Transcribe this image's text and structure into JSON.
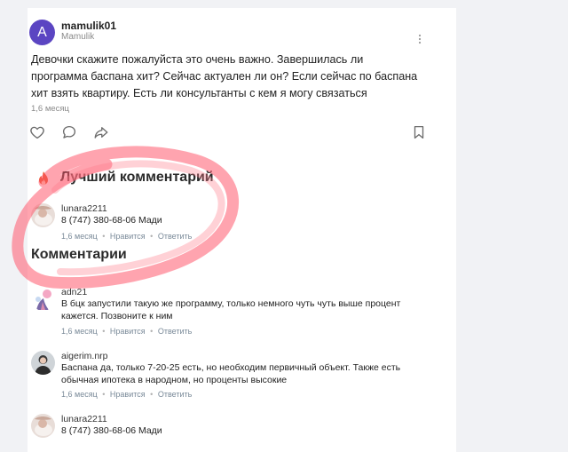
{
  "post": {
    "avatar_letter": "A",
    "author": "mamulik01",
    "author_sub": "Mamulik",
    "text": "Девочки скажите пожалуйста это очень важно. Завершилась ли программа баспана хит? Сейчас актуален ли он? Если сейчас по баспана хит взять квартиру. Есть ли консультанты с кем я могу связаться",
    "time": "1,6 месяц"
  },
  "best_comment": {
    "title": "Лучший комментарий",
    "user": "lunara2211",
    "text": "8 (747) 380-68-06 Мади",
    "time": "1,6 месяц",
    "like": "Нравится",
    "reply": "Ответить"
  },
  "comments_title": "Комментарии",
  "comments": [
    {
      "user": "adn21",
      "text": "В бцк запустили такую же программу, только немного чуть чуть выше процент кажется. Позвоните к ним",
      "time": "1,6 месяц",
      "like": "Нравится",
      "reply": "Ответить"
    },
    {
      "user": "aigerim.nrp",
      "text": "Баспана да, только 7-20-25 есть, но необходим первичный объект. Также есть обычная ипотека в народном, но проценты высокие",
      "time": "1,6 месяц",
      "like": "Нравится",
      "reply": "Ответить"
    },
    {
      "user": "lunara2211",
      "text": "8 (747) 380-68-06 Мади"
    }
  ],
  "icons": {
    "more": "more-vertical-icon",
    "like": "heart-icon",
    "comment": "comment-icon",
    "share": "share-icon",
    "bookmark": "bookmark-icon",
    "flame": "flame-icon"
  },
  "colors": {
    "avatar_bg": "#5b45c2",
    "flame": "#e8552b",
    "meta": "#7a8a99",
    "highlight_mark": "#ff5a6e"
  }
}
